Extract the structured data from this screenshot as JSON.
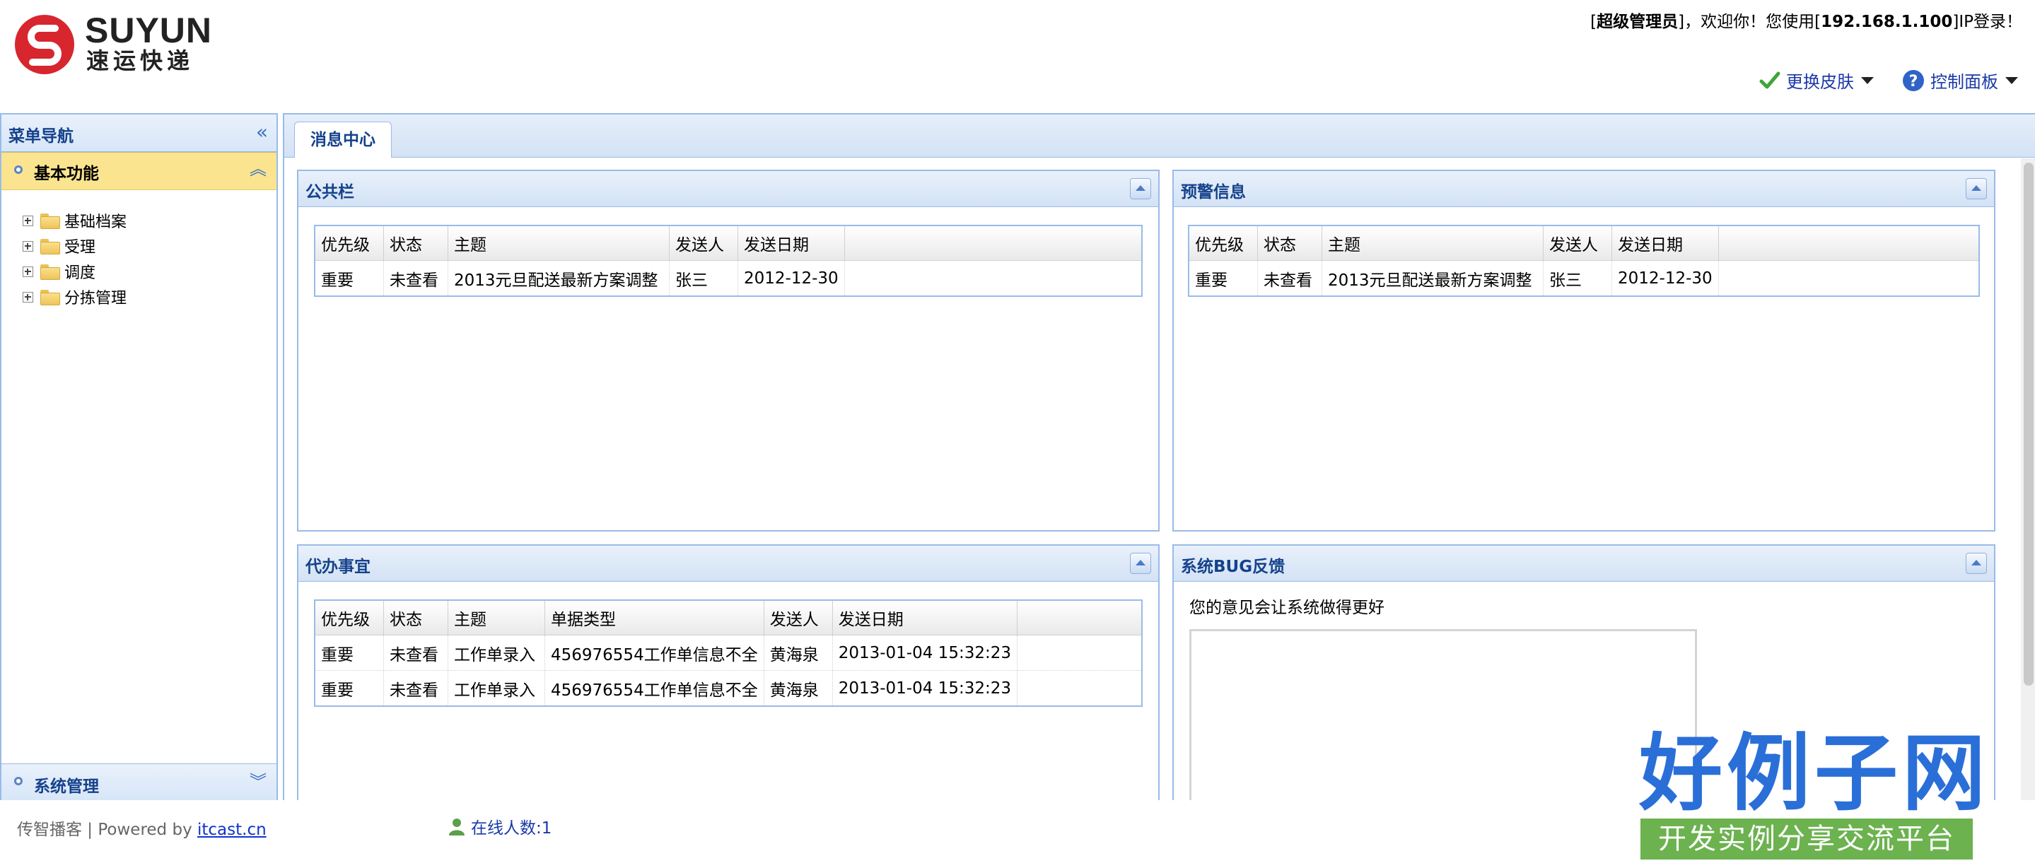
{
  "header": {
    "logo_en": "SUYUN",
    "logo_cn": "速运快递",
    "welcome_role": "超级管理员",
    "welcome_mid": "，欢迎你！您使用",
    "welcome_ip": "192.168.1.100",
    "welcome_tail": "IP登录！",
    "menu_skin": "更换皮肤",
    "menu_panel": "控制面板"
  },
  "sidebar": {
    "title": "菜单导航",
    "basic_title": "基本功能",
    "tree": [
      "基础档案",
      "受理",
      "调度",
      "分拣管理"
    ],
    "system_title": "系统管理"
  },
  "tabs": [
    "消息中心"
  ],
  "notice": {
    "title": "公共栏",
    "columns": [
      "优先级",
      "状态",
      "主题",
      "发送人",
      "发送日期"
    ],
    "rows": [
      [
        "重要",
        "未查看",
        "2013元旦配送最新方案调整",
        "张三",
        "2012-12-30"
      ]
    ]
  },
  "warning": {
    "title": "预警信息",
    "columns": [
      "优先级",
      "状态",
      "主题",
      "发送人",
      "发送日期"
    ],
    "rows": [
      [
        "重要",
        "未查看",
        "2013元旦配送最新方案调整",
        "张三",
        "2012-12-30"
      ]
    ]
  },
  "todo": {
    "title": "代办事宜",
    "columns": [
      "优先级",
      "状态",
      "主题",
      "单据类型",
      "发送人",
      "发送日期"
    ],
    "rows": [
      [
        "重要",
        "未查看",
        "工作单录入",
        "456976554工作单信息不全",
        "黄海泉",
        "2013-01-04 15:32:23"
      ],
      [
        "重要",
        "未查看",
        "工作单录入",
        "456976554工作单信息不全",
        "黄海泉",
        "2013-01-04 15:32:23"
      ]
    ]
  },
  "bug": {
    "title": "系统BUG反馈",
    "text": "您的意见会让系统做得更好"
  },
  "footer": {
    "credit_prefix": "传智播客 | Powered by ",
    "credit_link": "itcast.cn",
    "online": "在线人数:1"
  },
  "watermark": {
    "brand": "好例子网",
    "sub": "开发实例分享交流平台"
  },
  "icons": {
    "skin": "checkmark-icon",
    "panel": "help-icon",
    "online": "user-icon"
  },
  "colors": {
    "accent": "#15428b",
    "border": "#99bbe8",
    "active_accordion": "#fbe48f"
  }
}
